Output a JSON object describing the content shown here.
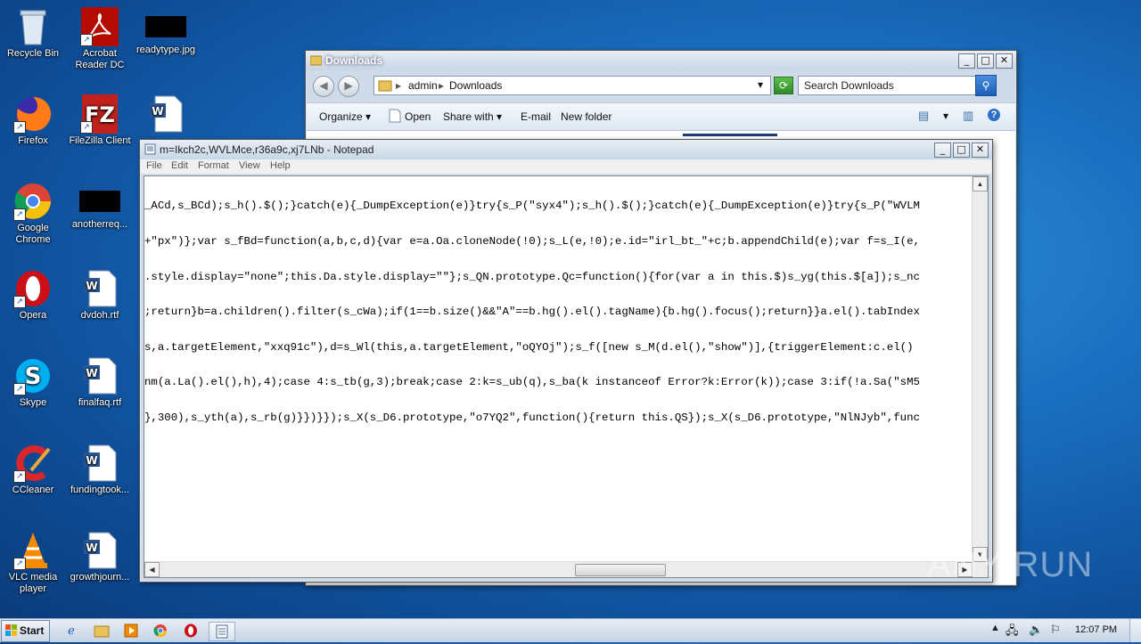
{
  "desktop": {
    "icons": [
      {
        "label": "Recycle Bin"
      },
      {
        "label": "Acrobat Reader DC"
      },
      {
        "label": "readytype.jpg"
      },
      {
        "label": "Firefox"
      },
      {
        "label": "FileZilla Client"
      },
      {
        "label": "Google Chrome"
      },
      {
        "label": "anotherreq..."
      },
      {
        "label": "Opera"
      },
      {
        "label": "dvdoh.rtf"
      },
      {
        "label": "Skype"
      },
      {
        "label": "finalfaq.rtf"
      },
      {
        "label": "CCleaner"
      },
      {
        "label": "fundingtook..."
      },
      {
        "label": "VLC media player"
      },
      {
        "label": "growthjourn..."
      }
    ]
  },
  "explorer": {
    "title": "Downloads",
    "breadcrumb": [
      "admin",
      "Downloads"
    ],
    "search_placeholder": "Search Downloads",
    "commands": [
      "Organize",
      "Open",
      "Share with",
      "E-mail",
      "New folder"
    ]
  },
  "notepad": {
    "title": "m=Ikch2c,WVLMce,r36a9c,xj7LNb - Notepad",
    "menu": [
      "File",
      "Edit",
      "Format",
      "View",
      "Help"
    ],
    "lines": [
      "_ACd,s_BCd);s_h().$();}catch(e){_DumpException(e)}try{s_P(\"syx4\");s_h().$();}catch(e){_DumpException(e)}try{s_P(\"WVLM",
      "+\"px\")};var s_fBd=function(a,b,c,d){var e=a.Oa.cloneNode(!0);s_L(e,!0);e.id=\"irl_bt_\"+c;b.appendChild(e);var f=s_I(e,",
      ".style.display=\"none\";this.Da.style.display=\"\"};s_QN.prototype.Qc=function(){for(var a in this.$)s_yg(this.$[a]);s_nc",
      ";return}b=a.children().filter(s_cWa);if(1==b.size()&&\"A\"==b.hg().el().tagName){b.hg().focus();return}}a.el().tabIndex",
      "s,a.targetElement,\"xxq91c\"),d=s_Wl(this,a.targetElement,\"oQYOj\");s_f([new s_M(d.el(),\"show\")],{triggerElement:c.el()",
      "nm(a.La().el(),h),4);case 4:s_tb(g,3);break;case 2:k=s_ub(q),s_ba(k instanceof Error?k:Error(k));case 3:if(!a.Sa(\"sM5",
      "},300),s_yth(a),s_rb(g)}})}});s_X(s_D6.prototype,\"o7YQ2\",function(){return this.QS});s_X(s_D6.prototype,\"NlNJyb\",func"
    ]
  },
  "taskbar": {
    "start_label": "Start",
    "clock": "12:07 PM"
  },
  "watermark": "ANY RUN"
}
